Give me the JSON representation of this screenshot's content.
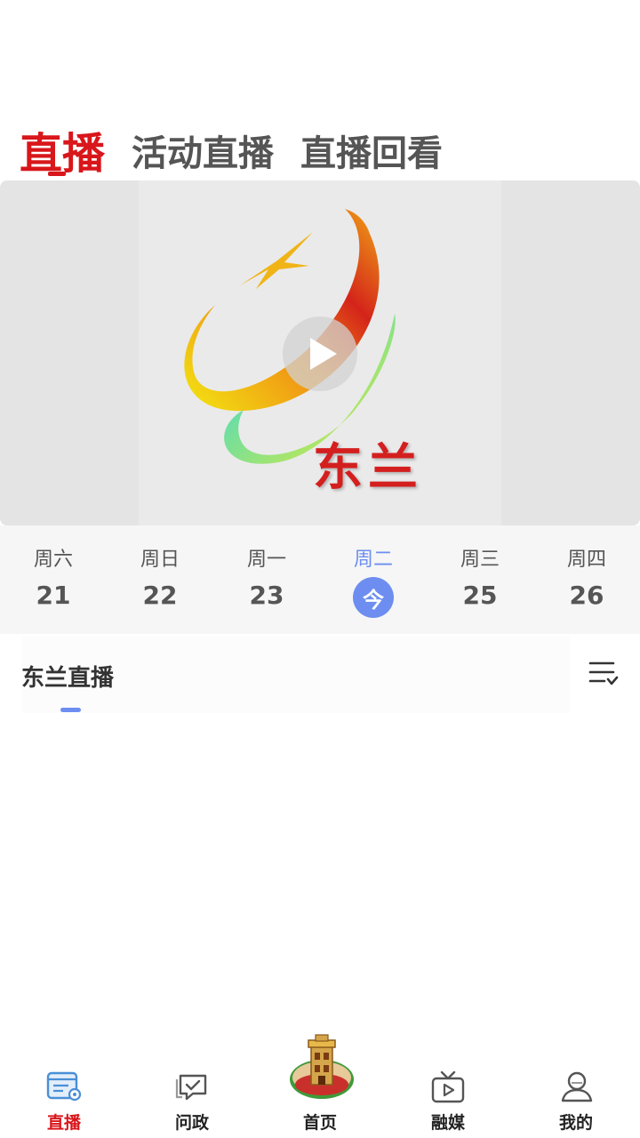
{
  "top_tabs": [
    {
      "label": "直播",
      "active": true
    },
    {
      "label": "活动直播",
      "active": false
    },
    {
      "label": "直播回看",
      "active": false
    }
  ],
  "player": {
    "logo_text": "东兰",
    "play_icon": "play-icon"
  },
  "days": [
    {
      "name": "周六",
      "num": "21"
    },
    {
      "name": "周日",
      "num": "22"
    },
    {
      "name": "周一",
      "num": "23"
    },
    {
      "name": "周二",
      "num": "今",
      "active": true
    },
    {
      "name": "周三",
      "num": "25"
    },
    {
      "name": "周四",
      "num": "26"
    }
  ],
  "channel": {
    "label": "东兰直播",
    "menu_icon": "list-filter-icon"
  },
  "bottom_nav": [
    {
      "label": "直播",
      "icon": "live-icon",
      "active": true
    },
    {
      "label": "问政",
      "icon": "chat-icon"
    },
    {
      "label": "首页",
      "icon": "home-logo"
    },
    {
      "label": "融媒",
      "icon": "tv-icon"
    },
    {
      "label": "我的",
      "icon": "user-icon"
    }
  ],
  "colors": {
    "accent_red": "#d8161b",
    "accent_blue": "#6d8ef0"
  }
}
